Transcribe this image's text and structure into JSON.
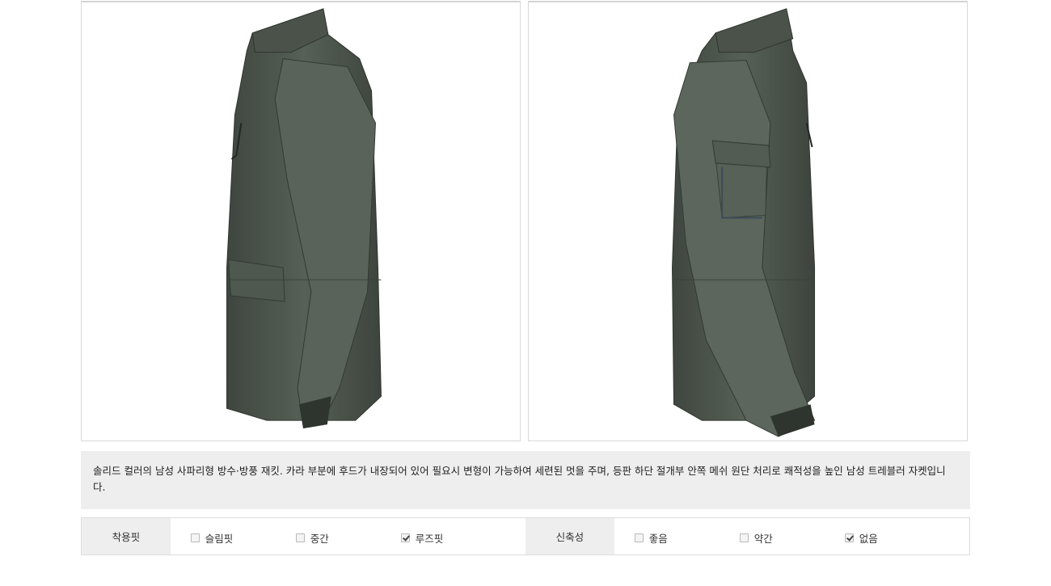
{
  "images": {
    "left_alt": "jacket-side-view-left",
    "right_alt": "jacket-side-view-right",
    "jacket_color": "#4d554c"
  },
  "description": "솔리드 컬러의 남성 사파리형 방수·방풍 재킷. 카라 부분에 후드가 내장되어 있어 필요시 변형이 가능하여 세련된 멋을 주며, 등판 하단 절개부 안쪽 메쉬 원단 처리로 쾌적성을 높인 남성 트레블러 자켓입니다.",
  "specs": [
    {
      "label": "착용핏",
      "options": [
        {
          "label": "슬림핏",
          "checked": false
        },
        {
          "label": "중간",
          "checked": false
        },
        {
          "label": "루즈핏",
          "checked": true
        }
      ]
    },
    {
      "label": "신축성",
      "options": [
        {
          "label": "좋음",
          "checked": false
        },
        {
          "label": "약간",
          "checked": false
        },
        {
          "label": "없음",
          "checked": true
        }
      ]
    }
  ]
}
